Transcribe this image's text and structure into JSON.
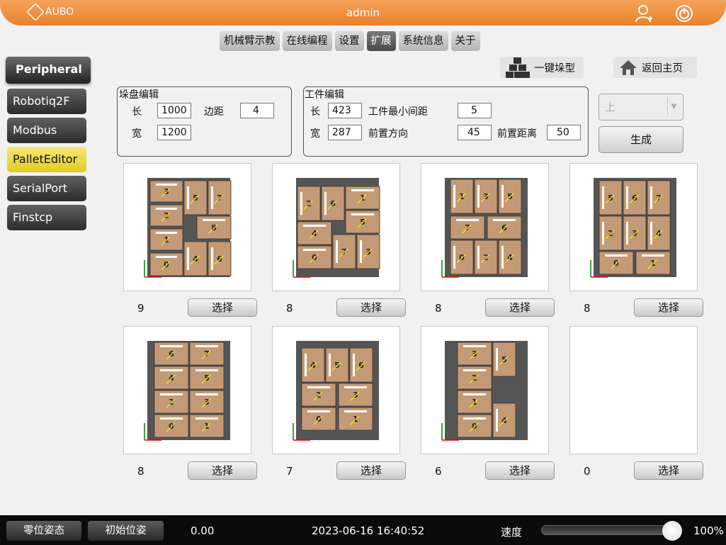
{
  "header": {
    "logo": "AUBO",
    "title": "admin",
    "user_icon": "user-icon",
    "power_icon": "power-icon"
  },
  "tabs": [
    "机械臂示教",
    "在线编程",
    "设置",
    "扩展",
    "系统信息",
    "关于"
  ],
  "active_tab": "扩展",
  "sidebar": {
    "title": "Peripheral",
    "items": [
      "Robotiq2F",
      "Modbus",
      "PalletEditor",
      "SerialPort",
      "Finstcp"
    ],
    "active": "PalletEditor"
  },
  "actions": {
    "stack": "一键垛型",
    "home": "返回主页"
  },
  "pallet": {
    "title": "垛盘编辑",
    "length_label": "长",
    "length": "1000",
    "width_label": "宽",
    "width": "1200",
    "margin_label": "边距",
    "margin": "4"
  },
  "workpiece": {
    "title": "工件编辑",
    "length_label": "长",
    "length": "423",
    "width_label": "宽",
    "width": "287",
    "min_gap_label": "工件最小间距",
    "min_gap": "5",
    "dir_label": "前置方向",
    "dir": "45",
    "dist_label": "前置距离",
    "dist": "50"
  },
  "direction_select": "上",
  "generate": "生成",
  "select_label": "选择",
  "patterns": [
    {
      "count": "9",
      "boxes": [
        [
          4,
          4,
          46,
          30,
          "3",
          "h"
        ],
        [
          52,
          4,
          32,
          48,
          "5",
          "v"
        ],
        [
          86,
          4,
          32,
          48,
          "7",
          "v"
        ],
        [
          4,
          38,
          46,
          30,
          "2",
          "h"
        ],
        [
          70,
          54,
          48,
          32,
          "8",
          "h"
        ],
        [
          4,
          72,
          46,
          30,
          "1",
          "h"
        ],
        [
          4,
          106,
          46,
          32,
          "0",
          "h"
        ],
        [
          52,
          90,
          32,
          48,
          "4",
          "v"
        ],
        [
          86,
          90,
          32,
          48,
          "6",
          "v"
        ]
      ]
    },
    {
      "count": "8",
      "boxes": [
        [
          2,
          12,
          32,
          48,
          "2",
          "v"
        ],
        [
          36,
          12,
          32,
          48,
          "6",
          "v"
        ],
        [
          70,
          12,
          48,
          32,
          "1",
          "h"
        ],
        [
          70,
          46,
          48,
          32,
          "5",
          "h"
        ],
        [
          2,
          62,
          48,
          32,
          "4",
          "h"
        ],
        [
          52,
          80,
          32,
          48,
          "7",
          "v"
        ],
        [
          86,
          80,
          32,
          48,
          "3",
          "v"
        ],
        [
          2,
          96,
          48,
          32,
          "0",
          "h"
        ]
      ]
    },
    {
      "count": "8",
      "boxes": [
        [
          8,
          2,
          32,
          48,
          "1",
          "v"
        ],
        [
          42,
          2,
          32,
          48,
          "3",
          "v"
        ],
        [
          76,
          2,
          32,
          48,
          "5",
          "v"
        ],
        [
          8,
          54,
          48,
          32,
          "7",
          "h"
        ],
        [
          60,
          54,
          48,
          32,
          "6",
          "h"
        ],
        [
          8,
          88,
          32,
          48,
          "0",
          "v"
        ],
        [
          42,
          88,
          32,
          48,
          "2",
          "v"
        ],
        [
          76,
          88,
          32,
          48,
          "4",
          "v"
        ]
      ]
    },
    {
      "count": "8",
      "boxes": [
        [
          8,
          4,
          32,
          48,
          "5",
          "v"
        ],
        [
          42,
          4,
          32,
          48,
          "6",
          "v"
        ],
        [
          76,
          4,
          32,
          48,
          "7",
          "v"
        ],
        [
          8,
          54,
          32,
          48,
          "2",
          "v"
        ],
        [
          42,
          54,
          32,
          48,
          "3",
          "v"
        ],
        [
          76,
          54,
          32,
          48,
          "4",
          "v"
        ],
        [
          8,
          104,
          48,
          32,
          "0",
          "h"
        ],
        [
          60,
          104,
          48,
          32,
          "1",
          "h"
        ]
      ]
    },
    {
      "count": "8",
      "boxes": [
        [
          10,
          2,
          48,
          32,
          "6",
          "h"
        ],
        [
          60,
          2,
          48,
          32,
          "7",
          "h"
        ],
        [
          10,
          36,
          48,
          32,
          "4",
          "h"
        ],
        [
          60,
          36,
          48,
          32,
          "5",
          "h"
        ],
        [
          10,
          70,
          48,
          32,
          "2",
          "h"
        ],
        [
          60,
          70,
          48,
          32,
          "3",
          "h"
        ],
        [
          10,
          104,
          48,
          32,
          "0",
          "h"
        ],
        [
          60,
          104,
          48,
          32,
          "1",
          "h"
        ]
      ]
    },
    {
      "count": "7",
      "boxes": [
        [
          8,
          10,
          32,
          48,
          "4",
          "v"
        ],
        [
          42,
          10,
          32,
          48,
          "5",
          "v"
        ],
        [
          76,
          10,
          32,
          48,
          "6",
          "v"
        ],
        [
          8,
          60,
          48,
          32,
          "2",
          "h"
        ],
        [
          60,
          60,
          48,
          32,
          "3",
          "h"
        ],
        [
          8,
          94,
          48,
          32,
          "0",
          "h"
        ],
        [
          60,
          94,
          48,
          32,
          "1",
          "h"
        ]
      ]
    },
    {
      "count": "6",
      "boxes": [
        [
          18,
          2,
          48,
          32,
          "3",
          "h"
        ],
        [
          68,
          2,
          32,
          48,
          "5",
          "v"
        ],
        [
          18,
          36,
          48,
          32,
          "2",
          "h"
        ],
        [
          18,
          70,
          48,
          32,
          "1",
          "h"
        ],
        [
          18,
          104,
          48,
          32,
          "0",
          "h"
        ],
        [
          68,
          88,
          32,
          48,
          "4",
          "v"
        ]
      ]
    },
    {
      "count": "0",
      "boxes": []
    }
  ],
  "colors": {
    "box": "#c49a76",
    "pallet": "#555555",
    "accent": "#e8822d"
  },
  "status": {
    "zero_btn": "零位姿态",
    "init_btn": "初始位姿",
    "value": "0.00",
    "datetime": "2023-06-16 16:40:52",
    "speed_label": "速度",
    "speed": "100%",
    "speed_fraction": 1.0
  }
}
